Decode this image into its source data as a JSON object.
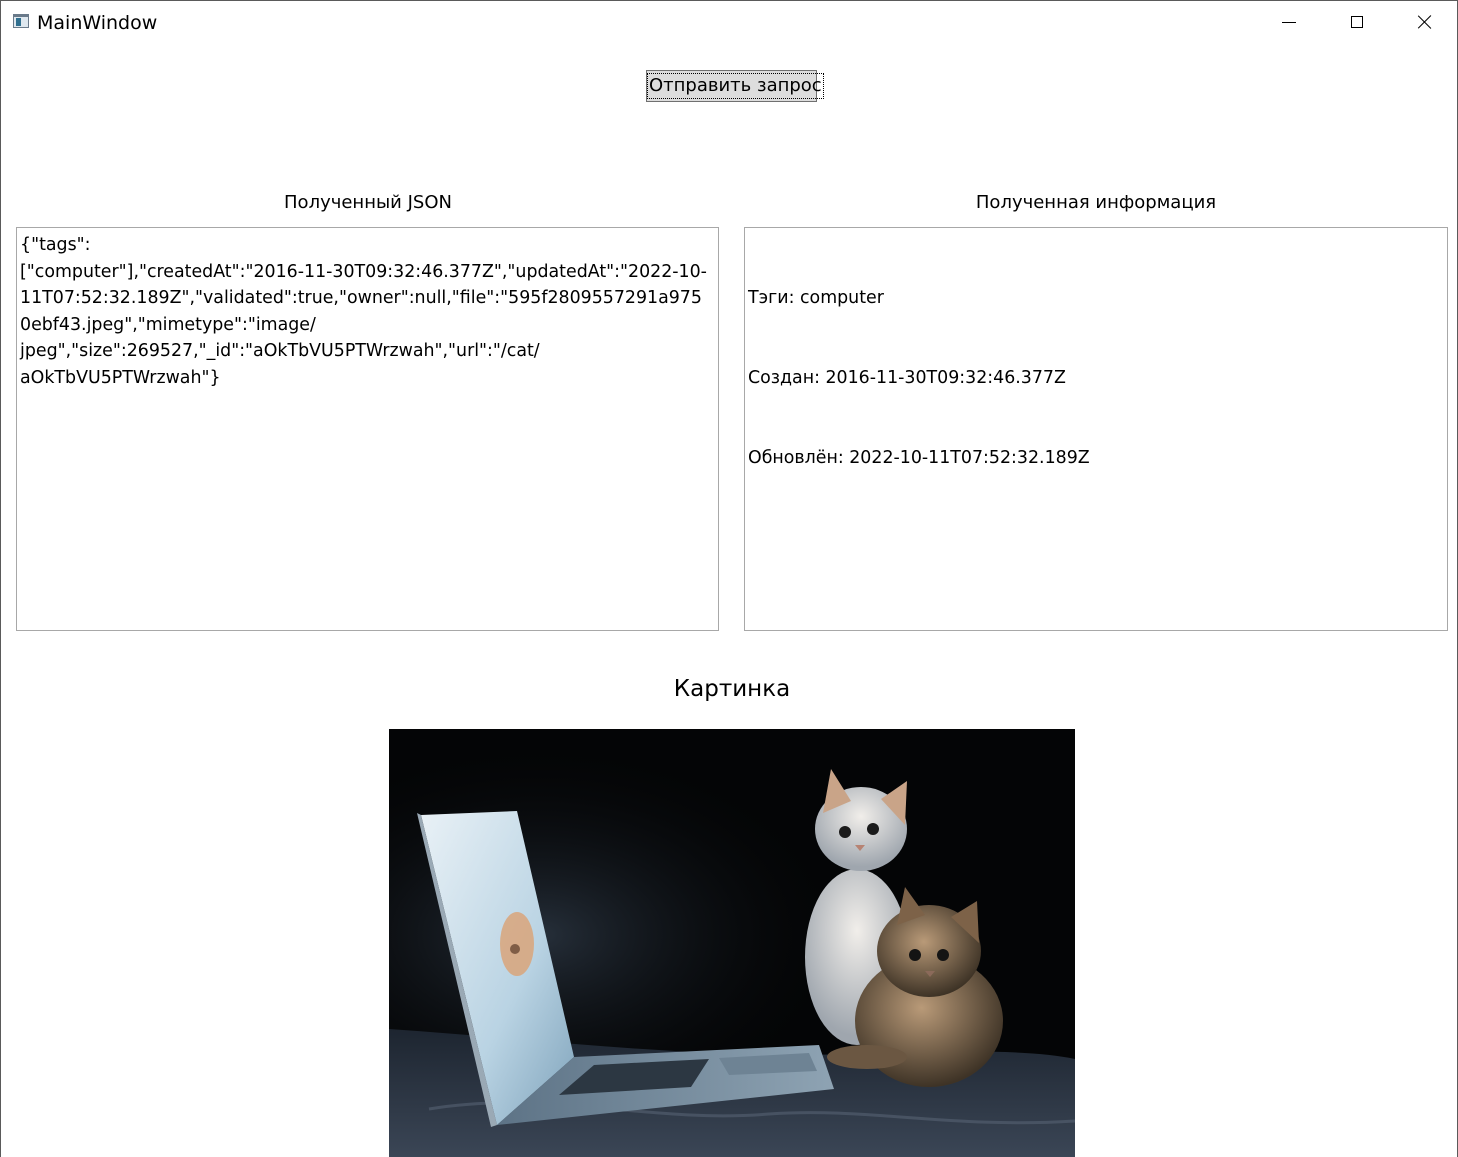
{
  "window": {
    "title": "MainWindow",
    "icons": [
      "app-icon",
      "minimize-icon",
      "maximize-icon",
      "close-icon"
    ]
  },
  "toolbar": {
    "send_label": "Отправить запрос"
  },
  "json_panel": {
    "label": "Полученный JSON",
    "content": "{\"tags\":\n[\"computer\"],\"createdAt\":\"2016-11-30T09:32:46.377Z\",\"updatedAt\":\"2022-10-11T07:52:32.189Z\",\"validated\":true,\"owner\":null,\"file\":\"595f2809557291a9750ebf43.jpeg\",\"mimetype\":\"image/\njpeg\",\"size\":269527,\"_id\":\"aOkTbVU5PTWrzwah\",\"url\":\"/cat/\naOkTbVU5PTWrzwah\"}"
  },
  "info_panel": {
    "label": "Полученная информация",
    "lines": [
      "Тэги: computer",
      "Создан: 2016-11-30T09:32:46.377Z",
      "Обновлён: 2022-10-11T07:52:32.189Z"
    ]
  },
  "image_panel": {
    "label": "Картинка",
    "content": "photo of two kittens looking at a laptop in the dark"
  }
}
